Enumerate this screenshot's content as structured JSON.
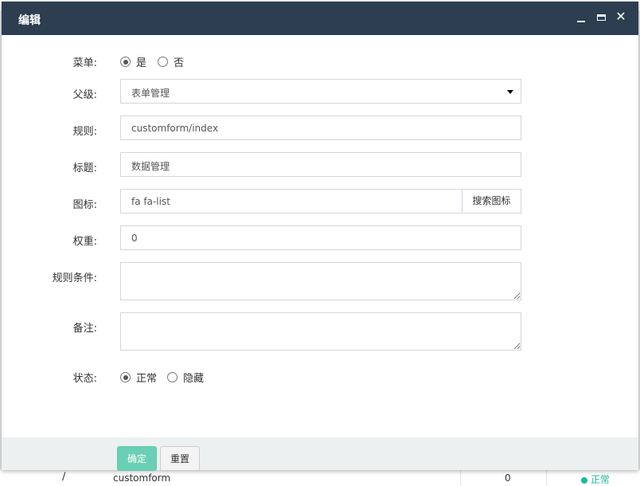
{
  "dialog": {
    "title": "编辑"
  },
  "form": {
    "menu": {
      "label": "菜单:",
      "options": [
        "是",
        "否"
      ],
      "selected": "是"
    },
    "parent": {
      "label": "父级:",
      "value": "表单管理"
    },
    "rule": {
      "label": "规则:",
      "value": "customform/index"
    },
    "title": {
      "label": "标题:",
      "value": "数据管理"
    },
    "icon": {
      "label": "图标:",
      "value": "fa fa-list",
      "button": "搜索图标"
    },
    "weight": {
      "label": "权重:",
      "value": "0"
    },
    "condition": {
      "label": "规则条件:",
      "value": ""
    },
    "remark": {
      "label": "备注:",
      "value": ""
    },
    "status": {
      "label": "状态:",
      "options": [
        "正常",
        "隐藏"
      ],
      "selected": "正常"
    }
  },
  "footer": {
    "ok_label": "确定",
    "reset_label": "重置"
  },
  "background_row": {
    "name": "customform",
    "weight": "0",
    "status": "正常"
  },
  "colors": {
    "titlebar": "#2c3e50",
    "ok_button": "#6ad0b5",
    "status_green": "#18bc9c"
  }
}
